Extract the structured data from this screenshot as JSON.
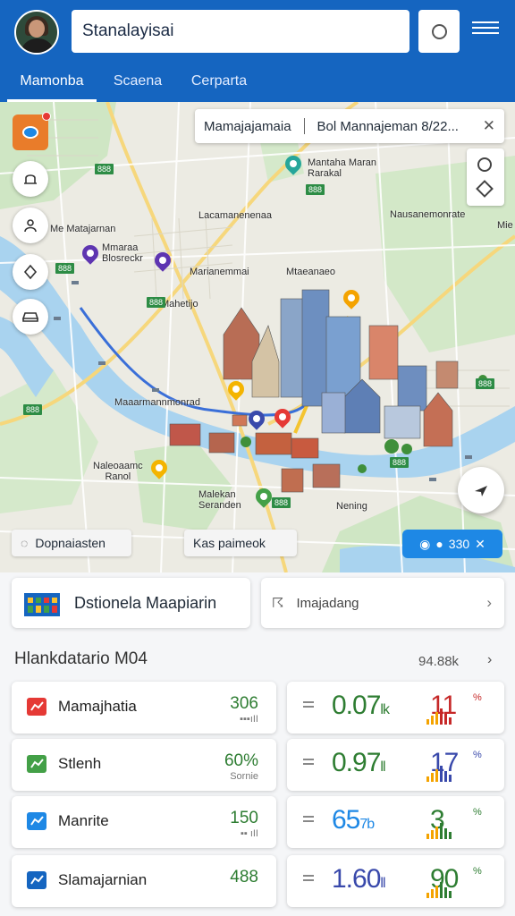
{
  "header": {
    "search_value": "Stanalayisai",
    "tabs": [
      {
        "label": "Mamonba",
        "active": true
      },
      {
        "label": "Scaena",
        "active": false
      },
      {
        "label": "Cerparta",
        "active": false
      }
    ],
    "brand_color": "#1565c0"
  },
  "map": {
    "route_card": {
      "origin": "Mamajajamaia",
      "destination": "Bol Mannajeman 8/22..."
    },
    "labels": [
      "Mantaha Maran\nRarakal",
      "Lacamanenenaa",
      "Nausanemonrate",
      "Mie",
      "Me Matajarnan",
      "Mmaraa\nBlosreckr",
      "Marianemmai",
      "Mtaeanaeo",
      "Mahetijo",
      "Maaarmannmonrad",
      "Naleoaamc\nRanol",
      "Malekan\nSeranden",
      "Nening"
    ],
    "shields": [
      "888",
      "888",
      "888",
      "888",
      "888",
      "888",
      "888",
      "888"
    ],
    "chips": {
      "left": "Dopnaiasten",
      "middle": "Kas paimeok",
      "blue": "330"
    }
  },
  "quick_cards": {
    "left": "Dstionela Maapiarin",
    "right": "Imajadang"
  },
  "section": {
    "title": "Hlankdatario M04",
    "count": "94.88k"
  },
  "stats": [
    {
      "name": "Mamajhatia",
      "value": "306",
      "sub": "▪▪▪ıII",
      "right_value": "0.07",
      "right_suffix": "lk",
      "right_pct": "11",
      "right_pct_note": "%",
      "value_color": "#2e7d32",
      "pct_color": "#c62828"
    },
    {
      "name": "Stlenh",
      "value": "60%",
      "sub": "Sornie",
      "right_value": "0.97",
      "right_suffix": "ll",
      "right_pct": "17",
      "right_pct_note": "%",
      "value_color": "#2e7d32",
      "pct_color": "#3949ab"
    },
    {
      "name": "Manrite",
      "value": "150",
      "sub": "▪▪ ıII",
      "right_value": "65",
      "right_suffix": "7b",
      "right_pct": "3",
      "right_pct_note": "%",
      "value_color": "#1e88e5",
      "pct_color": "#2e7d32"
    },
    {
      "name": "Slamajarnian",
      "value": "488",
      "sub": "",
      "right_value": "1.60",
      "right_suffix": "ll",
      "right_pct": "90",
      "right_pct_note": "%",
      "value_color": "#3949ab",
      "pct_color": "#2e7d32"
    }
  ],
  "icons": {
    "avatar": "user-avatar",
    "search_action": "circle-icon",
    "menu": "hamburger-icon",
    "layers": "layers-icon",
    "close": "close-icon",
    "navigate": "navigate-arrow-icon",
    "chevron": "chevron-right-icon"
  }
}
